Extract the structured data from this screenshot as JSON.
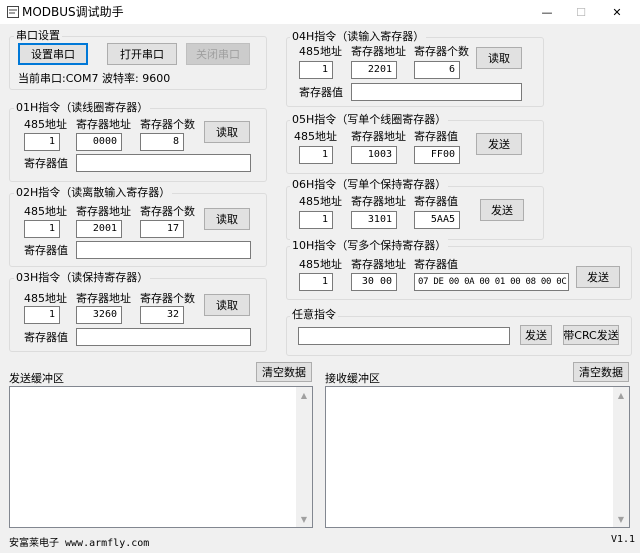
{
  "window": {
    "title": "MODBUS调试助手",
    "minimize": "—",
    "maximize": "☐",
    "close": "✕"
  },
  "serial": {
    "group_title": "串口设置",
    "setup_button": "设置串口",
    "open_button": "打开串口",
    "close_button": "关闭串口",
    "status": "当前串口:COM7 波特率: 9600"
  },
  "labels": {
    "addr485": "485地址",
    "reg_addr": "寄存器地址",
    "reg_count": "寄存器个数",
    "reg_value": "寄存器值",
    "read": "读取",
    "send": "发送"
  },
  "f01": {
    "title": "01H指令（读线圈寄存器）",
    "addr": "1",
    "reg_addr": "0000",
    "count": "8",
    "value": ""
  },
  "f02": {
    "title": "02H指令（读离散输入寄存器）",
    "addr": "1",
    "reg_addr": "2001",
    "count": "17",
    "value": ""
  },
  "f03": {
    "title": "03H指令（读保持寄存器）",
    "addr": "1",
    "reg_addr": "3260",
    "count": "32",
    "value": ""
  },
  "f04": {
    "title": "04H指令（读输入寄存器）",
    "addr": "1",
    "reg_addr": "2201",
    "count": "6",
    "value": ""
  },
  "f05": {
    "title": "05H指令（写单个线圈寄存器）",
    "addr": "1",
    "reg_addr": "1003",
    "value": "FF00"
  },
  "f06": {
    "title": "06H指令（写单个保持寄存器）",
    "addr": "1",
    "reg_addr": "3101",
    "value": "5AA5"
  },
  "f10": {
    "title": "10H指令（写多个保持寄存器）",
    "addr": "1",
    "reg_addr": "30 00",
    "value": "07 DE 00 0A 00 01 00 08 00 0C 00"
  },
  "any": {
    "title": "任意指令",
    "value": "",
    "send": "发送",
    "send_crc": "带CRC发送"
  },
  "buffers": {
    "send_label": "发送缓冲区",
    "recv_label": "接收缓冲区",
    "clear_send": "清空数据",
    "clear_recv": "清空数据"
  },
  "footer": {
    "company": "安富莱电子 www.armfly.com",
    "version": "V1.1"
  }
}
